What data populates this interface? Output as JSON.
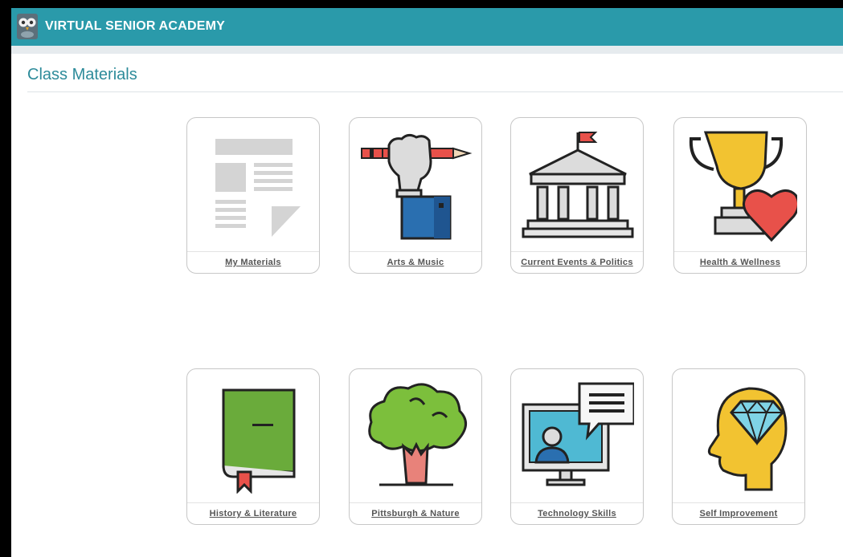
{
  "app": {
    "title": "VIRTUAL SENIOR ACADEMY"
  },
  "page": {
    "title": "Class Materials"
  },
  "tiles": [
    {
      "label": "My Materials"
    },
    {
      "label": "Arts & Music"
    },
    {
      "label": "Current Events & Politics"
    },
    {
      "label": "Health & Wellness"
    },
    {
      "label": "History & Literature"
    },
    {
      "label": "Pittsburgh & Nature"
    },
    {
      "label": "Technology Skills"
    },
    {
      "label": "Self Improvement"
    }
  ],
  "colors": {
    "header": "#2a9aaa",
    "title": "#2d8b9a"
  }
}
